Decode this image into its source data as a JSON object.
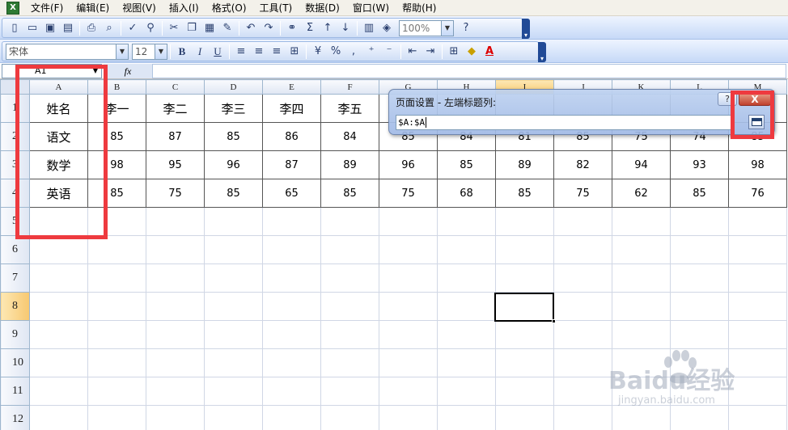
{
  "menu": {
    "items": [
      "文件(F)",
      "编辑(E)",
      "视图(V)",
      "插入(I)",
      "格式(O)",
      "工具(T)",
      "数据(D)",
      "窗口(W)",
      "帮助(H)"
    ]
  },
  "toolbar": {
    "zoom": "100%",
    "font_name": "宋体",
    "font_size": "12"
  },
  "formula_bar": {
    "name_box": "A1",
    "fx": "fx",
    "value": ""
  },
  "sheet": {
    "columns": [
      "A",
      "B",
      "C",
      "D",
      "E",
      "F",
      "G",
      "H",
      "I",
      "J",
      "K",
      "L",
      "M"
    ],
    "selected_column": "I",
    "rows": [
      "1",
      "2",
      "3",
      "4",
      "5",
      "6",
      "7",
      "8",
      "9",
      "10",
      "11",
      "12"
    ],
    "selected_row": "8",
    "data": [
      [
        "姓名",
        "李一",
        "李二",
        "李三",
        "李四",
        "李五",
        "",
        "",
        "",
        "",
        "",
        "",
        ""
      ],
      [
        "语文",
        "85",
        "87",
        "85",
        "86",
        "84",
        "85",
        "84",
        "81",
        "85",
        "75",
        "74",
        "85"
      ],
      [
        "数学",
        "98",
        "95",
        "96",
        "87",
        "89",
        "96",
        "85",
        "89",
        "82",
        "94",
        "93",
        "98"
      ],
      [
        "英语",
        "85",
        "75",
        "85",
        "65",
        "85",
        "75",
        "68",
        "85",
        "75",
        "62",
        "85",
        "76"
      ]
    ]
  },
  "dialog": {
    "title": "页面设置 - 左端标题列:",
    "help": "?",
    "close": "X",
    "value": "$A:$A"
  },
  "watermark": {
    "logo": "Baidu经验",
    "sub": "jingyan.baidu.com"
  },
  "colors": {
    "annotation": "#ee3a3f",
    "toolbar_accent": "#214a96"
  }
}
